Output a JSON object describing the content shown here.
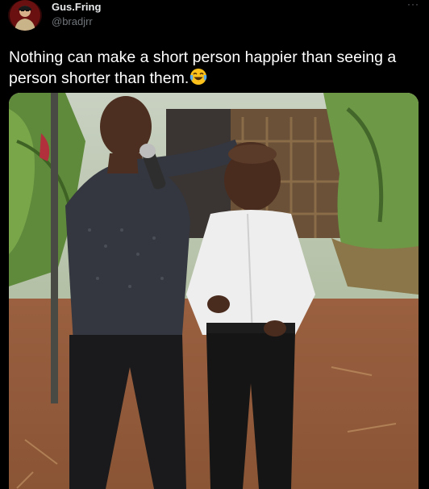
{
  "tweet": {
    "author": {
      "display_name": "Gus.Fring",
      "handle": "@bradjrr",
      "avatar_icon": "profile-avatar"
    },
    "more_icon": "ellipsis-icon",
    "more_label": "···",
    "text": "Nothing can make a short person happier than seeing a person shorter than them.",
    "emoji": "face-with-tears-of-joy-emoji",
    "media": {
      "type": "photo"
    }
  },
  "colors": {
    "background": "#000000",
    "primary_text": "#e7e9ea",
    "secondary_text": "#71767b"
  }
}
